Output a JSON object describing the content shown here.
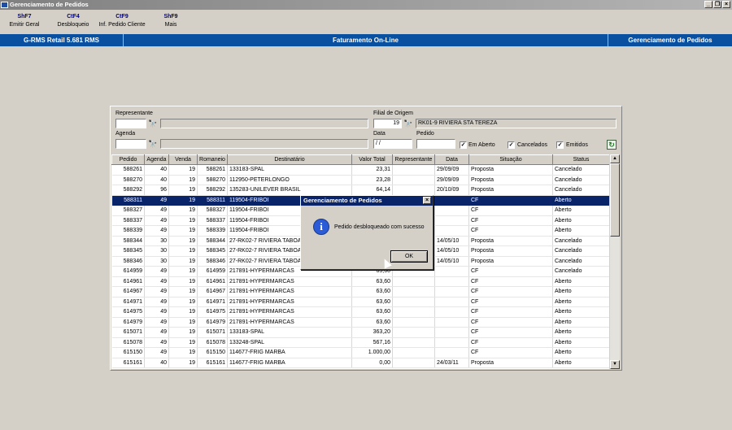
{
  "window": {
    "title": "Gerenciamento de Pedidos",
    "minimize": "_",
    "restore": "❐",
    "close": "×"
  },
  "toolbar": [
    {
      "key": "ShF7",
      "label": "Emitir Geral"
    },
    {
      "key": "CtF4",
      "label": "Desbloqueio"
    },
    {
      "key": "CtF9",
      "label": "Inf. Pedido Cliente"
    },
    {
      "key": "ShF9",
      "label": "Mais"
    }
  ],
  "status": {
    "left": "G-RMS Retail 5.681 RMS",
    "center": "Faturamento On-Line",
    "right": "Gerenciamento de Pedidos"
  },
  "filters": {
    "representante_label": "Representante",
    "representante_value": "",
    "representante_desc": "",
    "agenda_label": "Agenda",
    "agenda_value": "",
    "agenda_desc": "",
    "filial_label": "Filial de Origem",
    "filial_value": "19",
    "filial_desc": "RK01-9 RIVIERA STA TEREZA",
    "data_label": "Data",
    "data_value": "/ /",
    "pedido_label": "Pedido",
    "pedido_value": "",
    "em_aberto_label": "Em Aberto",
    "em_aberto_checked": "✓",
    "cancelados_label": "Cancelados",
    "cancelados_checked": "✓",
    "emitidos_label": "Emitidos",
    "emitidos_checked": "✓"
  },
  "table": {
    "headers": [
      "Pedido",
      "Agenda",
      "Venda",
      "Romaneio",
      "Destinatário",
      "Valor Total",
      "Representante",
      "Data",
      "Situação",
      "Status"
    ],
    "rows": [
      [
        "588261",
        "40",
        "19",
        "588261",
        "133183-SPAL",
        "23,31",
        "",
        "29/09/09",
        "Proposta",
        "Cancelado"
      ],
      [
        "588270",
        "40",
        "19",
        "588270",
        "112950-PETERLONGO",
        "23,28",
        "",
        "29/09/09",
        "Proposta",
        "Cancelado"
      ],
      [
        "588292",
        "96",
        "19",
        "588292",
        "135283-UNILEVER BRASIL",
        "64,14",
        "",
        "20/10/09",
        "Proposta",
        "Cancelado"
      ],
      [
        "588311",
        "49",
        "19",
        "588311",
        "119504-FRIBOI",
        "",
        "",
        "",
        "CF",
        "Aberto"
      ],
      [
        "588327",
        "49",
        "19",
        "588327",
        "119504-FRIBOI",
        "",
        "",
        "",
        "CF",
        "Aberto"
      ],
      [
        "588337",
        "49",
        "19",
        "588337",
        "119504-FRIBOI",
        "",
        "",
        "",
        "CF",
        "Aberto"
      ],
      [
        "588339",
        "49",
        "19",
        "588339",
        "119504-FRIBOI",
        "",
        "",
        "",
        "CF",
        "Aberto"
      ],
      [
        "588344",
        "30",
        "19",
        "588344",
        "27-RK02-7 RIVIERA TABOAO",
        "",
        "",
        "14/05/10",
        "Proposta",
        "Cancelado"
      ],
      [
        "588345",
        "30",
        "19",
        "588345",
        "27-RK02-7 RIVIERA TABOAO",
        "",
        "",
        "14/05/10",
        "Proposta",
        "Cancelado"
      ],
      [
        "588346",
        "30",
        "19",
        "588346",
        "27-RK02-7 RIVIERA TABOAO",
        "",
        "",
        "14/05/10",
        "Proposta",
        "Cancelado"
      ],
      [
        "614959",
        "49",
        "19",
        "614959",
        "217891-HYPERMARCAS",
        "63,60",
        "",
        "",
        "CF",
        "Cancelado"
      ],
      [
        "614961",
        "49",
        "19",
        "614961",
        "217891-HYPERMARCAS",
        "63,60",
        "",
        "",
        "CF",
        "Aberto"
      ],
      [
        "614967",
        "49",
        "19",
        "614967",
        "217891-HYPERMARCAS",
        "63,60",
        "",
        "",
        "CF",
        "Aberto"
      ],
      [
        "614971",
        "49",
        "19",
        "614971",
        "217891-HYPERMARCAS",
        "63,60",
        "",
        "",
        "CF",
        "Aberto"
      ],
      [
        "614975",
        "49",
        "19",
        "614975",
        "217891-HYPERMARCAS",
        "63,60",
        "",
        "",
        "CF",
        "Aberto"
      ],
      [
        "614979",
        "49",
        "19",
        "614979",
        "217891-HYPERMARCAS",
        "63,60",
        "",
        "",
        "CF",
        "Aberto"
      ],
      [
        "615071",
        "49",
        "19",
        "615071",
        "133183-SPAL",
        "363,20",
        "",
        "",
        "CF",
        "Aberto"
      ],
      [
        "615078",
        "49",
        "19",
        "615078",
        "133248-SPAL",
        "567,16",
        "",
        "",
        "CF",
        "Aberto"
      ],
      [
        "615150",
        "49",
        "19",
        "615150",
        "114677-FRIG MARBA",
        "1.000,00",
        "",
        "",
        "CF",
        "Aberto"
      ],
      [
        "615161",
        "40",
        "19",
        "615161",
        "114677-FRIG MARBA",
        "0,00",
        "",
        "24/03/11",
        "Proposta",
        "Aberto"
      ]
    ],
    "selected_row": 3
  },
  "dialog": {
    "title": "Gerenciamento de Pedidos",
    "message": "Pedido desbloqueado com sucesso",
    "ok": "OK",
    "close": "×",
    "icon": "i"
  },
  "icons": {
    "binoculars": "🔭",
    "refresh": "↻",
    "scroll_up": "▲",
    "scroll_down": "▼"
  }
}
